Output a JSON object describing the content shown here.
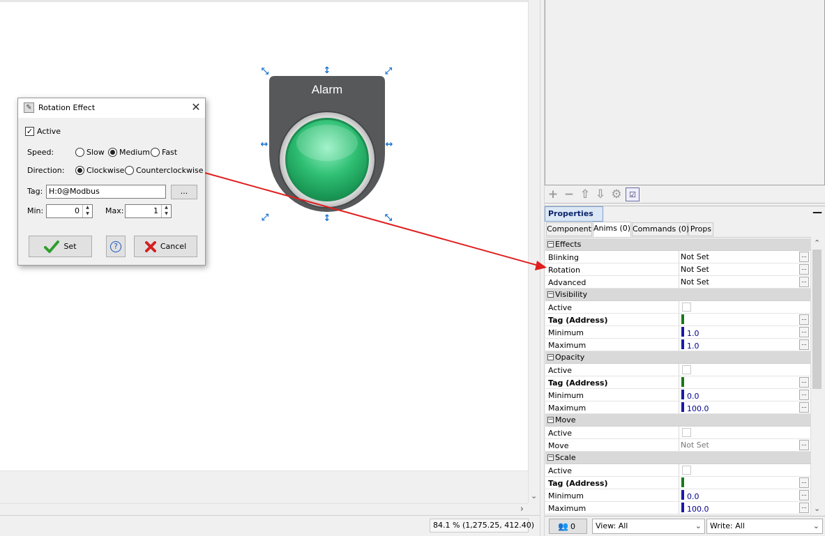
{
  "canvas": {
    "widget_label": "Alarm",
    "zoom_readout": "84.1 % (1,275.25, 412.40)"
  },
  "dialog": {
    "title": "Rotation Effect",
    "active_label": "Active",
    "active_checked": true,
    "speed_label": "Speed:",
    "speed_options": [
      "Slow",
      "Medium",
      "Fast"
    ],
    "speed_selected": "Medium",
    "direction_label": "Direction:",
    "direction_options": [
      "Clockwise",
      "Counterclockwise"
    ],
    "direction_selected": "Clockwise",
    "tag_label": "Tag:",
    "tag_value": "H:0@Modbus",
    "browse_label": "...",
    "min_label": "Min:",
    "min_value": "0",
    "max_label": "Max:",
    "max_value": "1",
    "set_label": "Set",
    "help_label": "?",
    "cancel_label": "Cancel"
  },
  "properties": {
    "title": "Properties",
    "minimize_label": "—",
    "tabs": [
      "Component",
      "Anims (0)",
      "Commands (0)",
      "Props"
    ],
    "active_tab": "Anims (0)",
    "rows": {
      "effects": "Effects",
      "blinking": {
        "name": "Blinking",
        "value": "Not Set"
      },
      "rotation": {
        "name": "Rotation",
        "value": "Not Set"
      },
      "advanced": {
        "name": "Advanced",
        "value": "Not Set"
      },
      "visibility": "Visibility",
      "vis_active": "Active",
      "vis_tag": "Tag (Address)",
      "vis_min": {
        "name": "Minimum",
        "value": "1.0"
      },
      "vis_max": {
        "name": "Maximum",
        "value": "1.0"
      },
      "opacity": "Opacity",
      "op_active": "Active",
      "op_tag": "Tag (Address)",
      "op_min": {
        "name": "Minimum",
        "value": "0.0"
      },
      "op_max": {
        "name": "Maximum",
        "value": "100.0"
      },
      "move": "Move",
      "mv_active": "Active",
      "mv_move": {
        "name": "Move",
        "value": "Not Set"
      },
      "scale": "Scale",
      "sc_active": "Active",
      "sc_tag": "Tag (Address)",
      "sc_min": {
        "name": "Minimum",
        "value": "0.0"
      },
      "sc_max": {
        "name": "Maximum",
        "value": "100.0"
      }
    },
    "ellipsis": "...",
    "users_count": "0",
    "view_combo": "View: All",
    "write_combo": "Write: All"
  },
  "colors": {
    "annotation_arrow": "#e01e1e",
    "alarm_body": "#57585a",
    "alarm_light": "#2fbf73",
    "handle": "#1a74d2"
  }
}
